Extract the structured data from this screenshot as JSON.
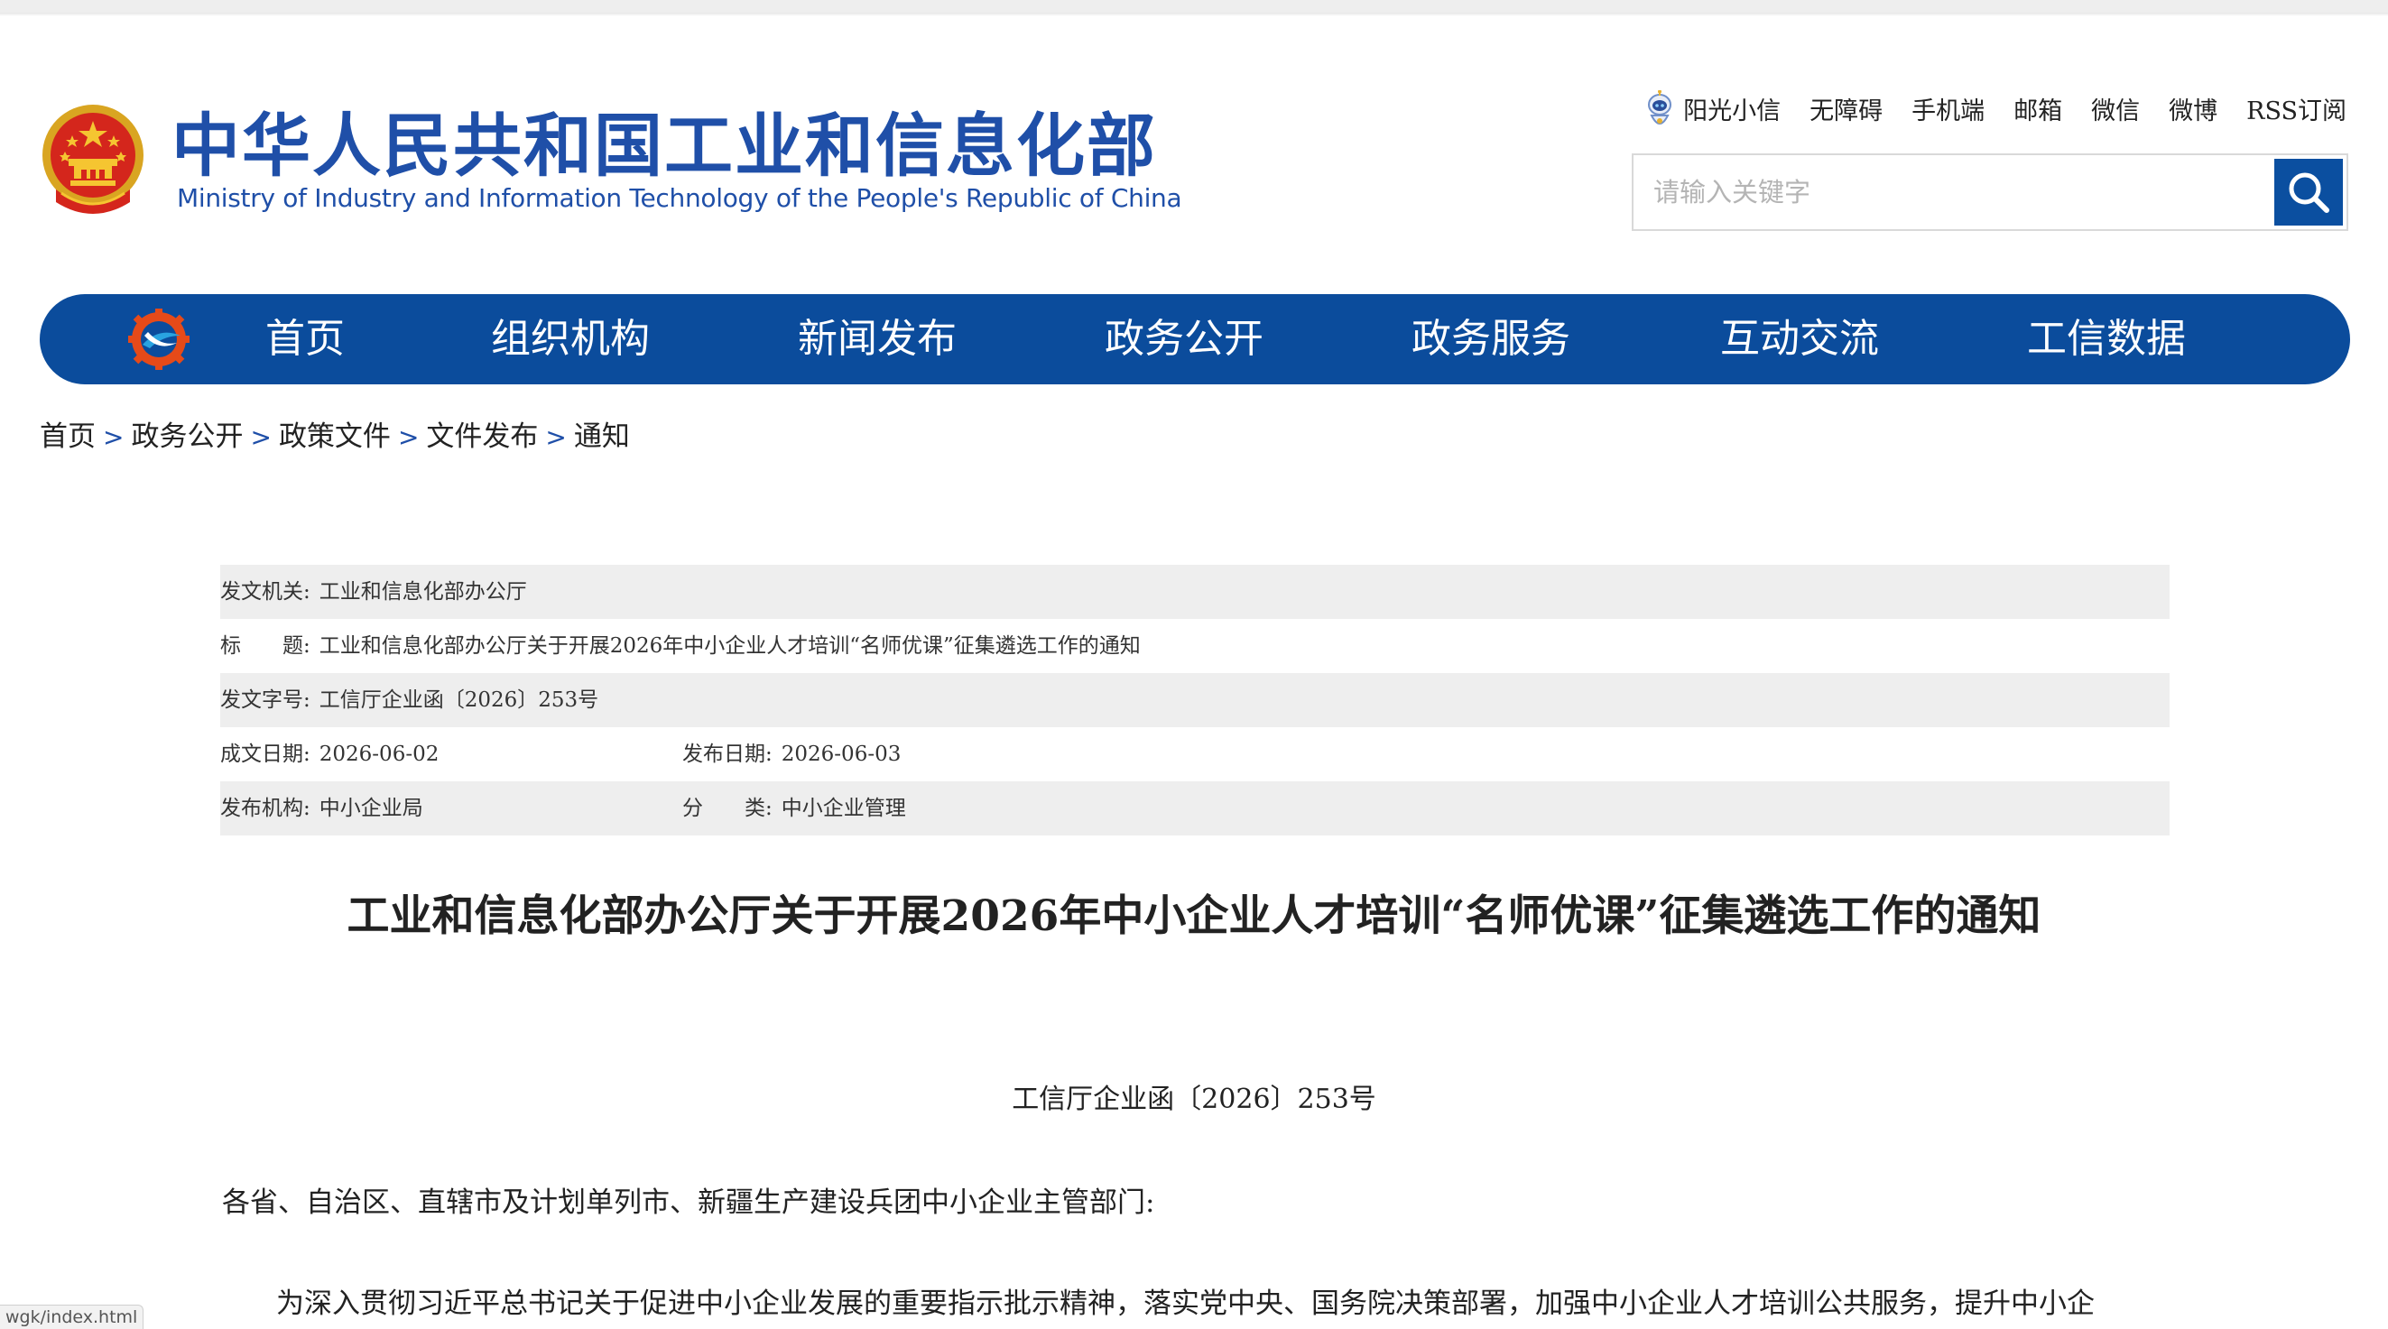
{
  "header": {
    "title_cn": "中华人民共和国工业和信息化部",
    "title_en": "Ministry of Industry and Information Technology of the People's Republic of China",
    "top_links": [
      "阳光小信",
      "无障碍",
      "手机端",
      "邮箱",
      "微信",
      "微博",
      "RSS订阅"
    ],
    "search_placeholder": "请输入关键字"
  },
  "nav": {
    "items": [
      "首页",
      "组织机构",
      "新闻发布",
      "政务公开",
      "政务服务",
      "互动交流",
      "工信数据"
    ]
  },
  "breadcrumb": [
    "首页",
    "政务公开",
    "政策文件",
    "文件发布",
    "通知"
  ],
  "breadcrumb_sep": ">",
  "meta": {
    "issuer_label": "发文机关:",
    "issuer_value": "工业和信息化部办公厅",
    "title_label": "标　　题:",
    "title_value": "工业和信息化部办公厅关于开展2026年中小企业人才培训“名师优课”征集遴选工作的通知",
    "docno_label": "发文字号:",
    "docno_value": "工信厅企业函〔2026〕253号",
    "created_label": "成文日期:",
    "created_value": "2026-06-02",
    "published_label": "发布日期:",
    "published_value": "2026-06-03",
    "org_label": "发布机构:",
    "org_value": "中小企业局",
    "category_label": "分　　类:",
    "category_value": "中小企业管理"
  },
  "article": {
    "title": "工业和信息化部办公厅关于开展2026年中小企业人才培训“名师优课”征集遴选工作的通知",
    "doc_number": "工信厅企业函〔2026〕253号",
    "salutation": "各省、自治区、直辖市及计划单列市、新疆生产建设兵团中小企业主管部门:",
    "paragraph_1": "为深入贯彻习近平总书记关于促进中小企业发展的重要指示批示精神，落实党中央、国务院决策部署，加强中小企业人才培训公共服务，提升中小企"
  },
  "status_bar": {
    "url": "wgk/index.html"
  },
  "colors": {
    "brand_blue": "#1f4fa8",
    "nav_blue": "#0b4c9c",
    "row_shade": "#eeeeee"
  }
}
